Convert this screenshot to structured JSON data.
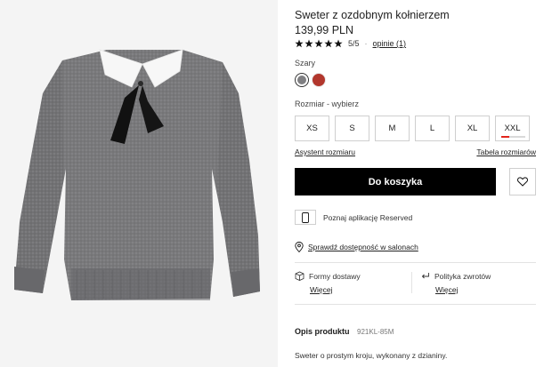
{
  "product": {
    "title": "Sweter z ozdobnym kołnierzem",
    "price": "139,99 PLN",
    "rating_value": 5,
    "rating_text": "5/5",
    "opinions_link": "opinie (1)",
    "image_alt": "Sweter z ozdobnym kołnierzem"
  },
  "colors": {
    "label": "Szary",
    "options": [
      {
        "name": "Szary",
        "hex": "#7f7f82",
        "selected": true
      },
      {
        "name": "Czerwony",
        "hex": "#b2372d",
        "selected": false
      }
    ]
  },
  "sizes": {
    "label": "Rozmiar -  wybierz",
    "options": [
      "XS",
      "S",
      "M",
      "L",
      "XL",
      "XXL"
    ],
    "low_stock": "XXL"
  },
  "links": {
    "size_assistant": "Asystent rozmiaru",
    "size_table": "Tabela rozmiarów"
  },
  "actions": {
    "add_to_cart": "Do koszyka",
    "wishlist_icon": "heart-icon"
  },
  "app_promo": {
    "text": "Poznaj aplikację Reserved",
    "icon": "phone-icon"
  },
  "stores": {
    "link": "Sprawdź dostępność w salonach",
    "icon": "location-pin-icon"
  },
  "delivery": {
    "title": "Formy dostawy",
    "link": "Więcej",
    "icon": "package-icon"
  },
  "returns": {
    "title": "Polityka zwrotów",
    "link": "Więcej",
    "icon": "return-arrow-icon"
  },
  "description": {
    "heading": "Opis produktu",
    "code": "921KL-85M",
    "text": "Sweter o prostym kroju, wykonany z dzianiny."
  },
  "theme": {
    "accent": "#000000",
    "low_stock_color": "#e2261c",
    "border": "#cfcfcf"
  }
}
